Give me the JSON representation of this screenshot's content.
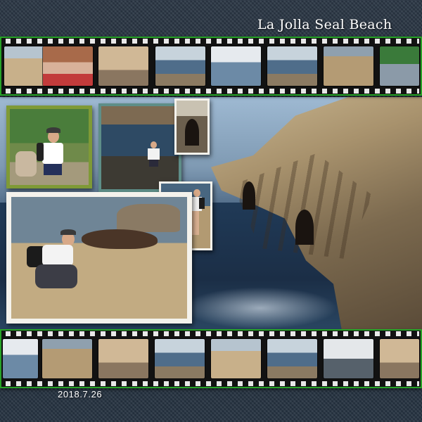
{
  "page": {
    "title": "La Jolla Seal Beach",
    "date": "2018.7.26"
  },
  "colors": {
    "film_border": "#2fb52f",
    "film_body": "#121212",
    "background": "#1f2a36",
    "photo_mat_green": "#7f9a36",
    "photo_mat_teal": "#5e8e88",
    "photo_mat_white": "#f4f2ec"
  },
  "top_strip": {
    "frames": [
      "boardwalk",
      "two-boys-smiling",
      "sea-lions-on-sand",
      "boy-on-rocks",
      "crowd-at-shore",
      "boy-by-ocean",
      "boy-on-cliff",
      "boy-at-railing"
    ]
  },
  "bottom_strip": {
    "frames": [
      "paraglider",
      "boy-crouching",
      "seal-on-rock",
      "surf",
      "seals-on-beach",
      "boy-backpack",
      "boy-at-edge",
      "seal-closeup"
    ]
  }
}
